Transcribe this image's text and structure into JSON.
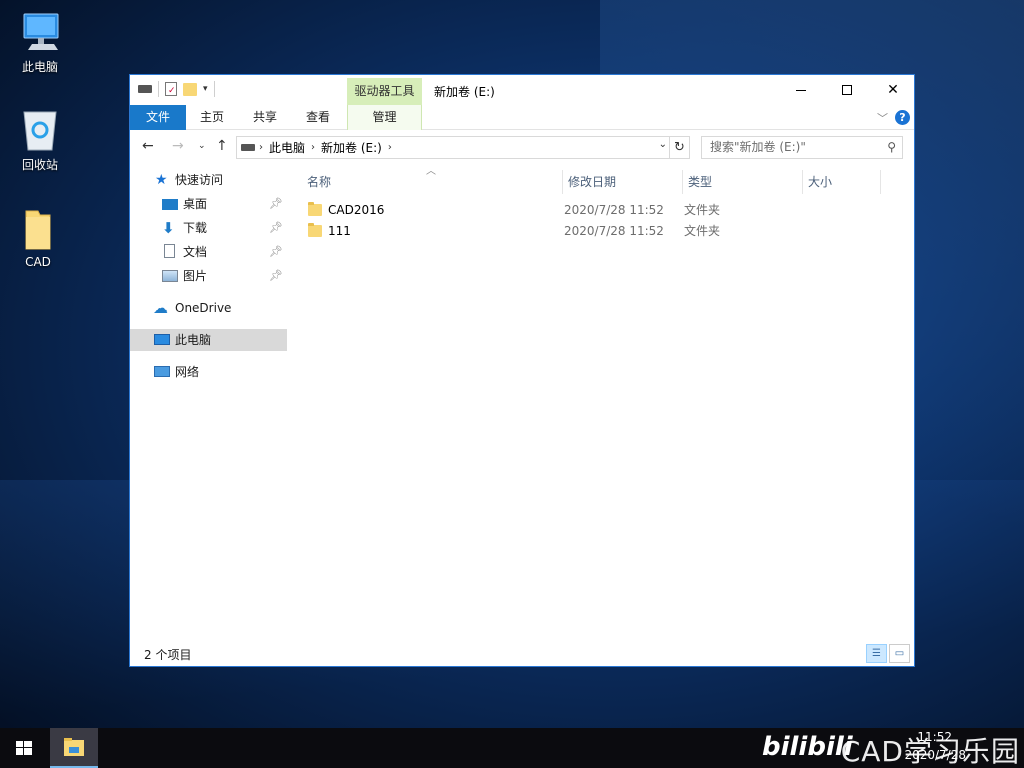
{
  "desktop": {
    "icons": [
      {
        "label": "此电脑",
        "icon": "computer-icon"
      },
      {
        "label": "回收站",
        "icon": "recycle-bin-icon"
      },
      {
        "label": "CAD",
        "icon": "folder-icon"
      }
    ]
  },
  "window": {
    "contextual_tab_group": "驱动器工具",
    "title": "新加卷 (E:)",
    "ribbon_tabs": [
      "文件",
      "主页",
      "共享",
      "查看",
      "管理"
    ],
    "controls": {
      "minimize": "—",
      "maximize": "☐",
      "close": "✕"
    }
  },
  "navbar": {
    "breadcrumb": [
      "此电脑",
      "新加卷 (E:)"
    ],
    "search_placeholder": "搜索\"新加卷 (E:)\""
  },
  "sidebar": {
    "quick_access": "快速访问",
    "pinned": [
      {
        "label": "桌面",
        "icon": "desktop-icon"
      },
      {
        "label": "下载",
        "icon": "download-icon"
      },
      {
        "label": "文档",
        "icon": "document-icon"
      },
      {
        "label": "图片",
        "icon": "picture-icon"
      }
    ],
    "onedrive": "OneDrive",
    "this_pc": "此电脑",
    "network": "网络"
  },
  "columns": {
    "name": "名称",
    "modified": "修改日期",
    "type": "类型",
    "size": "大小"
  },
  "files": [
    {
      "name": "CAD2016",
      "modified": "2020/7/28 11:52",
      "type": "文件夹"
    },
    {
      "name": "111",
      "modified": "2020/7/28 11:52",
      "type": "文件夹"
    }
  ],
  "status": {
    "item_count": "2 个项目"
  },
  "taskbar": {
    "time": "11:52",
    "date": "2020/7/28",
    "watermark_left": "bilibili",
    "watermark_right": "CAD学习乐园"
  }
}
